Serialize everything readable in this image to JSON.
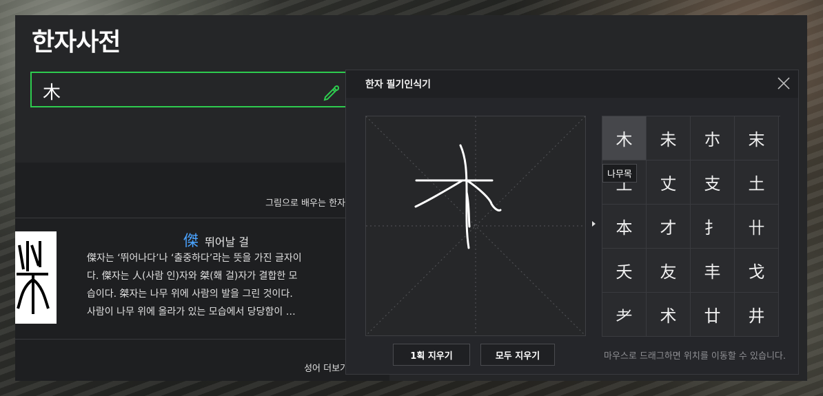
{
  "page": {
    "title": "한자사전"
  },
  "search": {
    "value": "木"
  },
  "content": {
    "promo_link": "그림으로 배우는 한자 더보기",
    "word": {
      "hanja": "傑",
      "reading": "뛰어날 걸",
      "desc_lines": [
        "傑자는 ‘뛰어나다’나 ‘출중하다’라는 뜻을 가진 글자이",
        "다. 傑자는 人(사람 인)자와 桀(홰 걸)자가 결합한 모",
        "습이다. 桀자는 나무 위에 사람의 발을 그린 것이다.",
        "사람이 나무 위에 올라가 있는 모습에서 당당함이 …"
      ]
    },
    "bottom_link": "성어 더보기"
  },
  "recognizer": {
    "title": "한자 필기인식기",
    "tooltip": "나무목",
    "candidates": [
      "木",
      "未",
      "朩",
      "末",
      "土",
      "丈",
      "支",
      "土",
      "本",
      "才",
      "扌",
      "卄",
      "夭",
      "友",
      "丰",
      "戈",
      "耂",
      "术",
      "廿",
      "井"
    ],
    "buttons": {
      "clear_one": "1획 지우기",
      "clear_all": "모두 지우기"
    },
    "hint": "마우스로 드래그하면 위치를 이동할 수 있습니다."
  },
  "colors": {
    "accent_green": "#2ecc4f",
    "link_blue": "#4aa3ff"
  }
}
